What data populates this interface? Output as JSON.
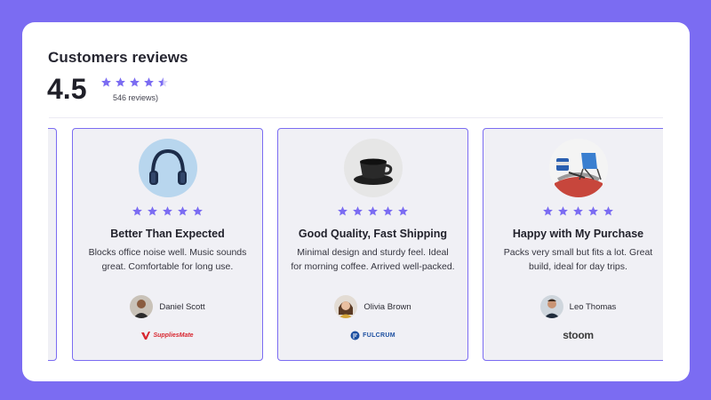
{
  "header": {
    "title": "Customers reviews",
    "rating": "4.5",
    "review_count": "546 reviews)",
    "stars_value": 4.5,
    "stars_max": 5
  },
  "colors": {
    "background": "#7b6cf2",
    "accent": "#7b6cf2",
    "star": "#7b6cf2",
    "card_bg": "#f0f0f5"
  },
  "reviews": [
    {
      "product_icon": "headphones-image",
      "stars": 5,
      "title": "Better Than Expected",
      "text": "Blocks office noise well. Music sounds great. Comfortable for long use.",
      "author": "Daniel Scott",
      "company_logo": "SuppliesMate",
      "company_logo_icon": "suppliesmate-logo"
    },
    {
      "product_icon": "coffee-cup-image",
      "stars": 5,
      "title": "Good Quality, Fast Shipping",
      "text": "Minimal design and sturdy feel. Ideal for morning coffee. Arrived well-packed.",
      "author": "Olivia Brown",
      "company_logo": "FULCRUM",
      "company_logo_icon": "fulcrum-logo"
    },
    {
      "product_icon": "camping-gear-image",
      "stars": 5,
      "title": "Happy with My Purchase",
      "text": "Packs very small but fits a lot. Great build, ideal for day trips.",
      "author": "Leo Thomas",
      "company_logo": "stoom",
      "company_logo_icon": "stoom-logo"
    }
  ]
}
